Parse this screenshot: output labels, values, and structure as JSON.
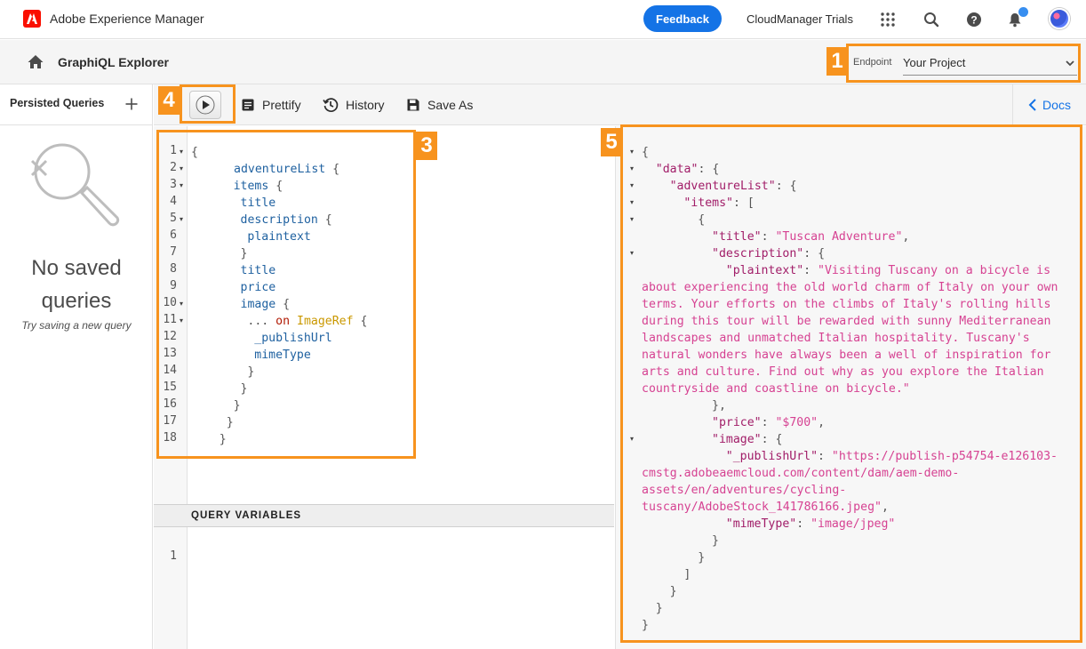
{
  "shell": {
    "app_title": "Adobe Experience Manager",
    "feedback_label": "Feedback",
    "org_name": "CloudManager Trials"
  },
  "subheader": {
    "title": "GraphiQL Explorer",
    "endpoint_label": "Endpoint",
    "endpoint_value": "Your Project"
  },
  "sidebar": {
    "title": "Persisted Queries",
    "empty_title_line1": "No saved",
    "empty_title_line2": "queries",
    "empty_subtitle": "Try saving a new query"
  },
  "toolbar": {
    "prettify_label": "Prettify",
    "history_label": "History",
    "save_as_label": "Save As",
    "docs_label": "Docs"
  },
  "query_variables": {
    "title": "QUERY VARIABLES",
    "line_numbers": [
      "1"
    ]
  },
  "editor": {
    "line_numbers": [
      "1",
      "2",
      "3",
      "4",
      "5",
      "6",
      "7",
      "8",
      "9",
      "10",
      "11",
      "12",
      "13",
      "14",
      "15",
      "16",
      "17",
      "18"
    ],
    "lines": [
      "{",
      "adventureList {",
      "items {",
      "title",
      "description {",
      "plaintext",
      "}",
      "title",
      "price",
      "image {",
      "... on ImageRef {",
      "_publishUrl",
      "mimeType",
      "}",
      "}",
      "}",
      "}",
      "}"
    ]
  },
  "result": {
    "keys": {
      "data": "\"data\"",
      "adventureList": "\"adventureList\"",
      "items": "\"items\"",
      "title": "\"title\"",
      "description": "\"description\"",
      "plaintext": "\"plaintext\"",
      "price": "\"price\"",
      "image": "\"image\"",
      "publishUrl": "\"_publishUrl\"",
      "mimeType": "\"mimeType\""
    },
    "title_value": "\"Tuscan Adventure\"",
    "plaintext_lines": [
      "\"Visiting Tuscany on a bicycle is",
      "about experiencing the old world charm of Italy on your own",
      "terms. Your efforts on the climbs of Italy's rolling hills",
      "during this tour will be rewarded with sunny Mediterranean",
      "landscapes and unmatched Italian hospitality. Tuscany's",
      "natural wonders have always been a well of inspiration for",
      "arts and culture. Find out why as you explore the Italian",
      "countryside and coastline on bicycle.\""
    ],
    "price_value": "\"$700\"",
    "publish_url_lines": [
      "\"https://publish-p54754-e126103-",
      "cmstg.adobeaemcloud.com/content/dam/aem-demo-",
      "assets/en/adventures/cycling-",
      "tuscany/AdobeStock_141786166.jpeg\""
    ],
    "mime_value": "\"image/jpeg\""
  },
  "callouts": {
    "endpoint": "1",
    "editor": "3",
    "run": "4",
    "result": "5"
  },
  "colors": {
    "accent": "#1473e6",
    "callout": "#f7931e",
    "adobe_red": "#fa0f00"
  }
}
